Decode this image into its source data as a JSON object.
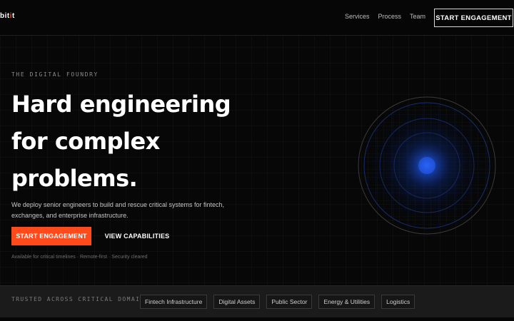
{
  "nav": {
    "logo_main": "bit",
    "logo_accent": "i",
    "logo_tail": "t",
    "links": [
      "Services",
      "Process",
      "Team"
    ],
    "cta_label": "START ENGAGEMENT"
  },
  "hero": {
    "eyebrow": "THE DIGITAL FOUNDRY",
    "headline_lines": [
      "Hard engineering",
      "for complex",
      "problems."
    ],
    "lede": "We deploy senior engineers to build and rescue critical systems for fintech, exchanges, and enterprise infrastructure.",
    "primary_cta": "START ENGAGEMENT",
    "secondary_cta": "VIEW CAPABILITIES",
    "meta": "Available for critical timelines · Remote-first · Security cleared"
  },
  "trust": {
    "label": "TRUSTED ACROSS CRITICAL DOMAINS",
    "tags": [
      "Fintech Infrastructure",
      "Digital Assets",
      "Public Sector",
      "Energy & Utilities",
      "Logistics"
    ]
  },
  "colors": {
    "accent": "#ff4a1c",
    "radar_glow": "#1f5bff",
    "background": "#070707"
  },
  "icons": {
    "radar": "radar-graphic"
  }
}
